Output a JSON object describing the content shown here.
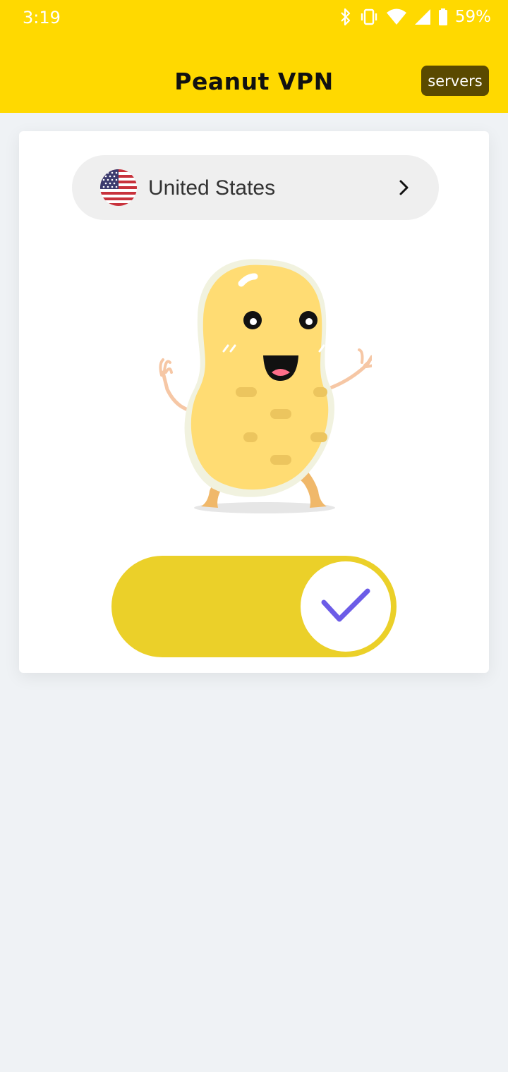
{
  "status_bar": {
    "time": "3:19",
    "battery_percent": "59%",
    "icons": [
      "bluetooth-icon",
      "vibrate-icon",
      "wifi-icon",
      "signal-icon",
      "battery-icon"
    ]
  },
  "app_bar": {
    "title": "Peanut VPN",
    "servers_label": "servers"
  },
  "location": {
    "country": "United States",
    "flag_icon": "us-flag-icon"
  },
  "connect_toggle": {
    "state": "on",
    "icon": "checkmark-icon"
  },
  "colors": {
    "brand_yellow": "#ffd900",
    "toggle_yellow": "#ebd029",
    "servers_button": "#5a4a00",
    "check_purple": "#6c5ce7",
    "background": "#eff2f5"
  }
}
